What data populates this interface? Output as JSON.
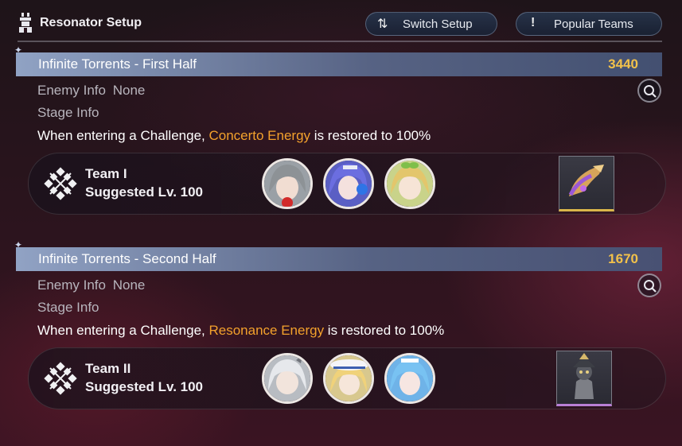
{
  "header": {
    "title": "Resonator Setup",
    "switch_setup_label": "Switch Setup",
    "popular_teams_label": "Popular Teams"
  },
  "colors": {
    "score": "#f2c14a",
    "highlight": "#f3a12c",
    "header_bar": "#8f9fc6"
  },
  "sections": [
    {
      "title": "Infinite Torrents - First Half",
      "score": "3440",
      "enemy_label": "Enemy Info",
      "enemy_value": "None",
      "stage_label": "Stage Info",
      "challenge_prefix": "When entering a Challenge, ",
      "challenge_highlight": "Concerto Energy",
      "challenge_suffix": " is restored to 100%",
      "team_name": "Team I",
      "team_level": "Suggested Lv. 100",
      "avatars": [
        "gray-haired-resonator-portrait",
        "blue-haired-resonator-portrait",
        "blonde-resonator-portrait"
      ],
      "reward_icon": "golden-horn-echo-icon"
    },
    {
      "title": "Infinite Torrents - Second Half",
      "score": "1670",
      "enemy_label": "Enemy Info",
      "enemy_value": "None",
      "stage_label": "Stage Info",
      "challenge_prefix": "When entering a Challenge, ",
      "challenge_highlight": "Resonance Energy",
      "challenge_suffix": " is restored to 100%",
      "team_name": "Team II",
      "team_level": "Suggested Lv. 100",
      "avatars": [
        "white-haired-resonator-portrait",
        "blonde-hat-resonator-portrait",
        "blue-haired-resonator-portrait"
      ],
      "reward_icon": "dark-armored-echo-icon"
    }
  ]
}
